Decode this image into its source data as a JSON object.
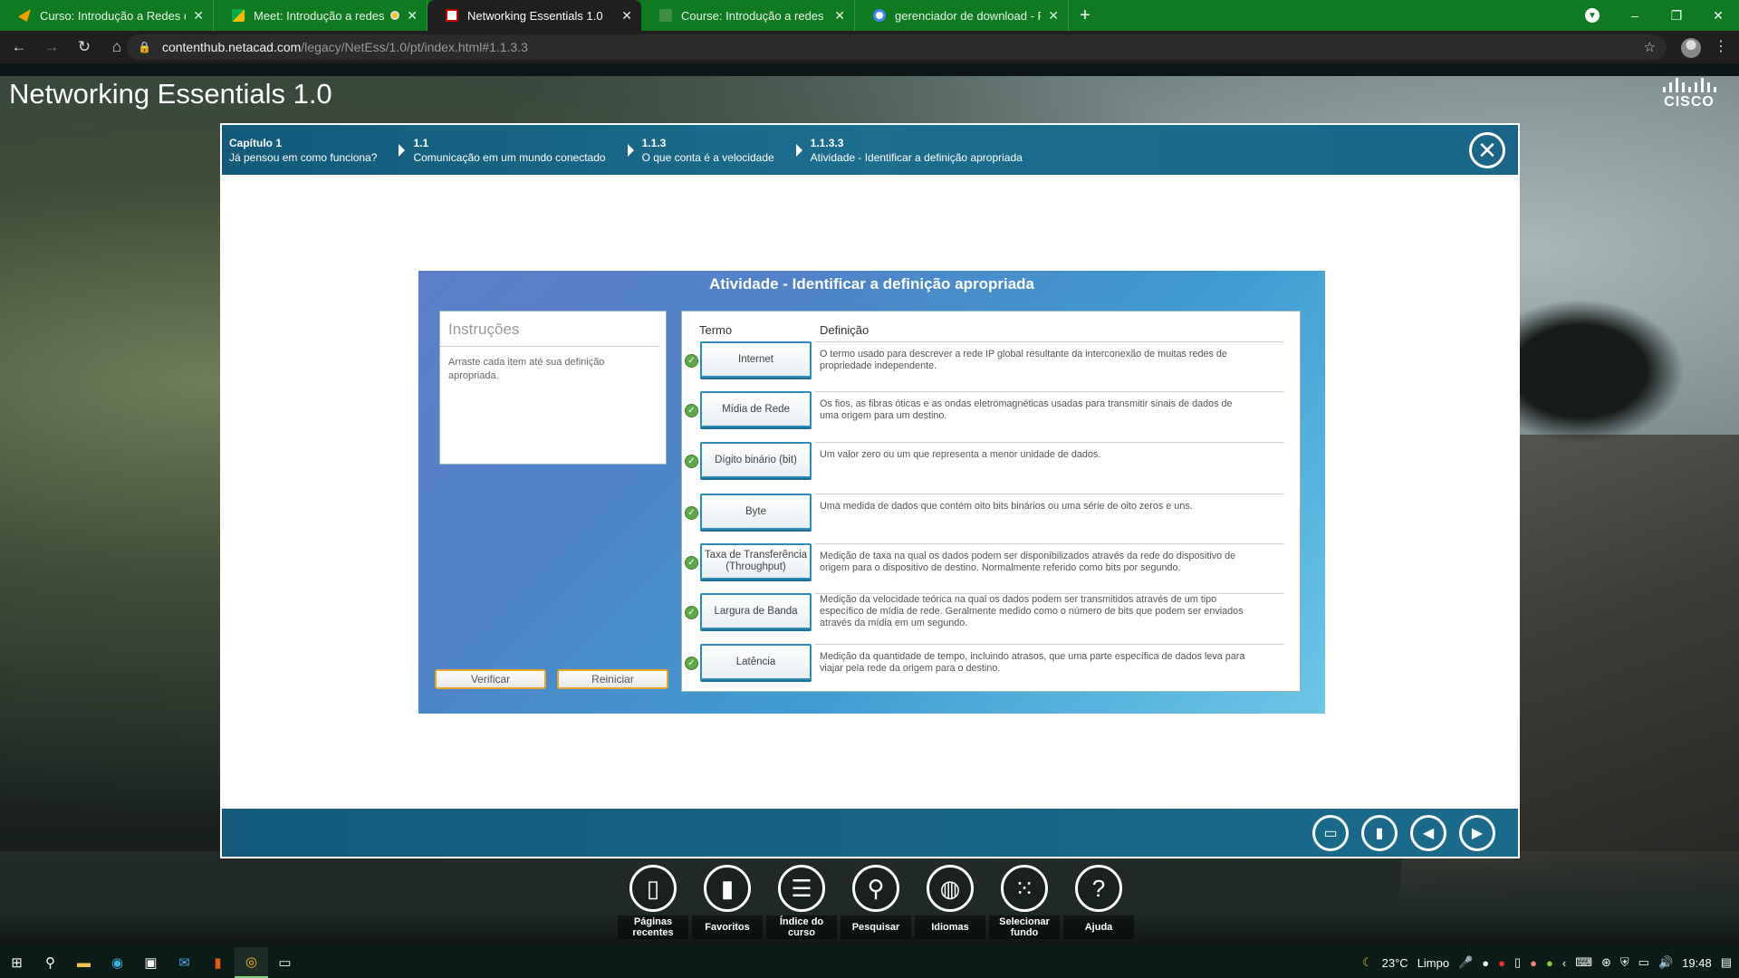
{
  "browser": {
    "tabs": [
      {
        "title": "Curso: Introdução a Redes de Co",
        "favicon_color": "#f4a100",
        "active": false
      },
      {
        "title": "Meet: Introdução a redes de",
        "favicon_color": "#00ac47",
        "active": false
      },
      {
        "title": "Networking Essentials 1.0",
        "favicon_color": "#ffffff",
        "active": true
      },
      {
        "title": "Course: Introdução a redes de co",
        "favicon_color": "#3f8f3f",
        "active": false
      },
      {
        "title": "gerenciador de download - Pesq",
        "favicon_color": "#ffffff",
        "active": false
      }
    ],
    "close_glyph": "✕",
    "new_tab_glyph": "+",
    "url_host": "contenthub.netacad.com",
    "url_path": "/legacy/NetEss/1.0/pt/index.html#1.1.3.3",
    "window_controls": [
      "–",
      "❐",
      "✕"
    ]
  },
  "app": {
    "title": "Networking Essentials 1.0",
    "logo_text": "CISCO"
  },
  "breadcrumb": [
    {
      "num": "Capítulo 1",
      "label": "Já pensou em como funciona?"
    },
    {
      "num": "1.1",
      "label": "Comunicação em um mundo conectado"
    },
    {
      "num": "1.1.3",
      "label": "O que conta é a velocidade"
    },
    {
      "num": "1.1.3.3",
      "label": "Atividade - Identificar a definição apropriada"
    }
  ],
  "activity": {
    "title": "Atividade - Identificar a definição apropriada",
    "instructions_title": "Instruções",
    "instructions_text": "Arraste cada item até sua definição apropriada.",
    "verify_label": "Verificar",
    "reset_label": "Reiniciar",
    "col_term": "Termo",
    "col_definition": "Definição",
    "rows": [
      {
        "term": "Internet",
        "definition": "O termo usado para descrever a rede IP global resultante da interconexão de muitas redes de propriedade independente.",
        "correct": true
      },
      {
        "term": "Mídia de Rede",
        "definition": "Os fios, as fibras óticas e as ondas eletromagnéticas usadas para transmitir sinais de dados de uma origem para um destino.",
        "correct": true
      },
      {
        "term": "Dígito binário (bit)",
        "definition": "Um valor zero ou um que representa a menor unidade de dados.",
        "correct": true
      },
      {
        "term": "Byte",
        "definition": "Uma medida de dados que contém oito bits binários ou uma série de oito zeros e uns.",
        "correct": true
      },
      {
        "term": "Taxa de Transferência (Throughput)",
        "definition": "Medição de taxa na qual os dados podem ser disponibilizados através da rede do dispositivo de origem para o dispositivo de destino. Normalmente referido como bits por segundo.",
        "correct": true
      },
      {
        "term": "Largura de Banda",
        "definition": "Medição da velocidade teórica na qual os dados podem ser transmitidos através de um tipo específico de mídia de rede. Geralmente medido como o número de bits que podem ser enviados através da mídia em um segundo.",
        "correct": true
      },
      {
        "term": "Latência",
        "definition": "Medição da quantidade de tempo, incluindo atrasos, que uma parte específica de dados leva para viajar pela rede da origem para o destino.",
        "correct": true
      }
    ]
  },
  "dock": [
    {
      "icon": "recent-pages-icon",
      "label": "Páginas recentes"
    },
    {
      "icon": "bookmark-icon",
      "label": "Favoritos"
    },
    {
      "icon": "list-icon",
      "label": "Índice do curso"
    },
    {
      "icon": "search-icon",
      "label": "Pesquisar"
    },
    {
      "icon": "globe-icon",
      "label": "Idiomas"
    },
    {
      "icon": "grid-icon",
      "label": "Selecionar fundo"
    },
    {
      "icon": "help-icon",
      "label": "Ajuda"
    }
  ],
  "taskbar": {
    "weather_temp": "23°C",
    "weather_text": "Limpo",
    "time": "19:48"
  },
  "colors": {
    "browser_green": "#0f7a1f",
    "frame_blue": "#135a7a",
    "term_border": "#2d8bb8",
    "check_green": "#5fa84a",
    "button_gold": "#e8a52a"
  }
}
